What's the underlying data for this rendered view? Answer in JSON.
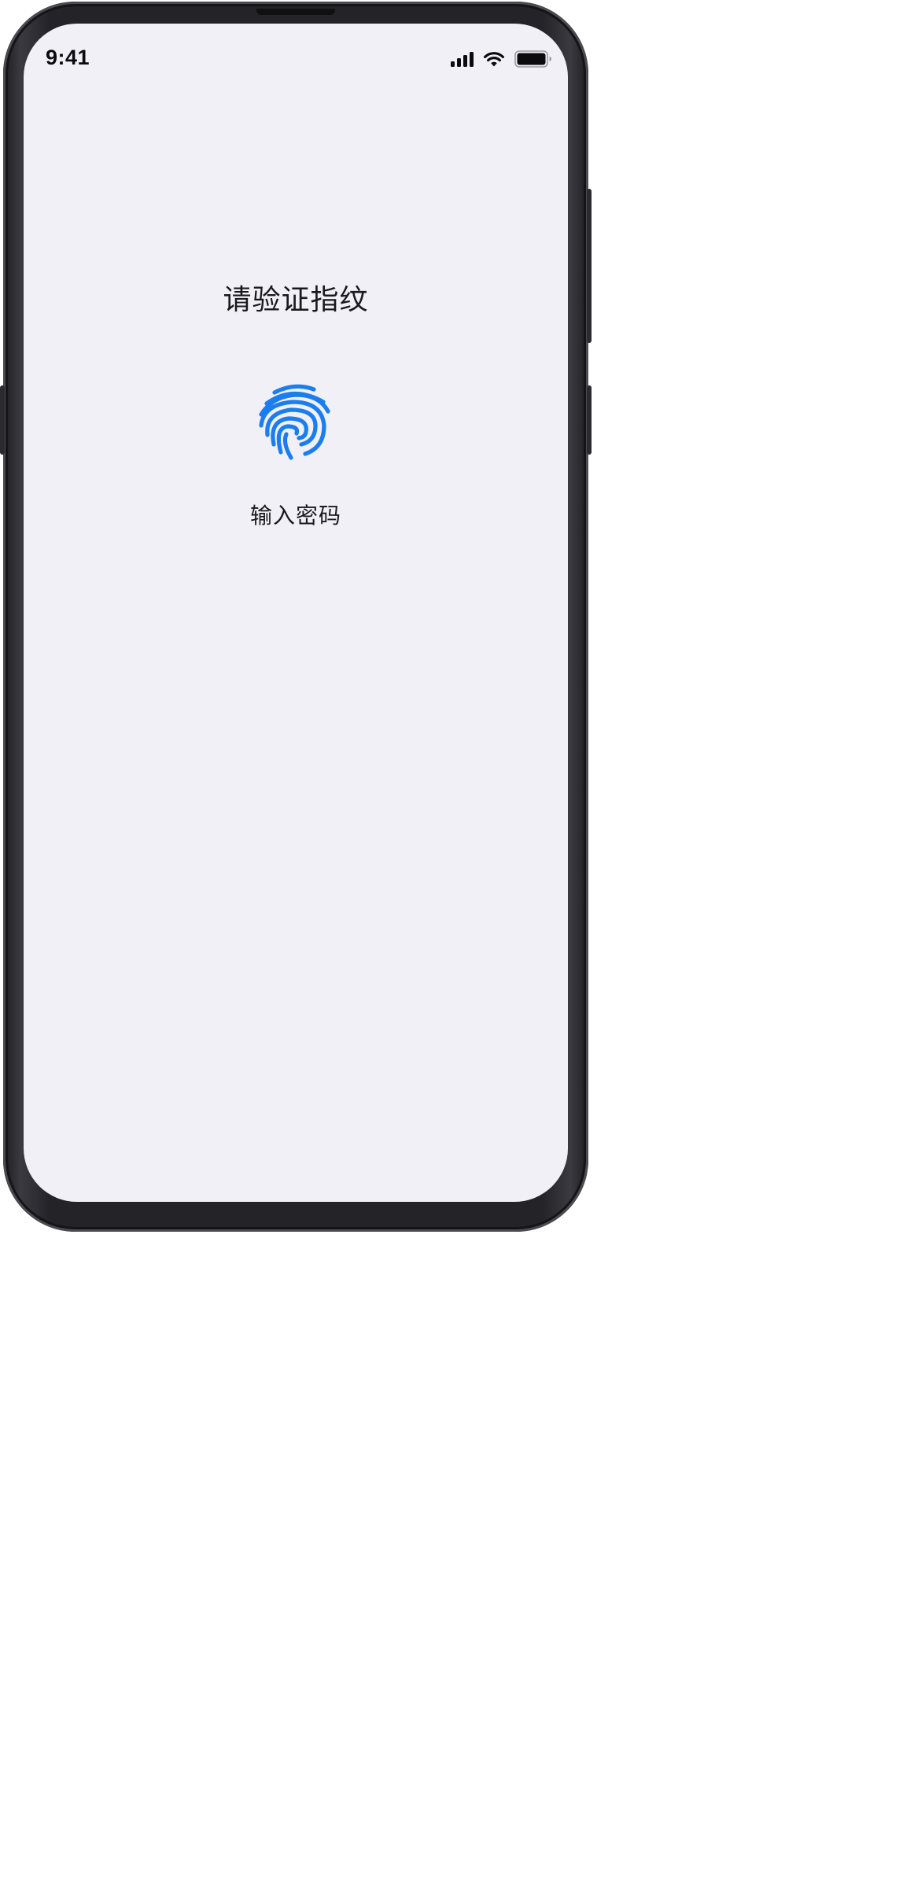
{
  "status_bar": {
    "time": "9:41",
    "icons": [
      "signal-icon",
      "wifi-icon",
      "battery-icon"
    ]
  },
  "auth": {
    "title": "请验证指纹",
    "icon": "fingerprint-icon",
    "password_label": "输入密码"
  },
  "colors": {
    "accent": "#1a7df0",
    "screen_background": "#f1f0f6",
    "text": "#1a1a1c"
  }
}
